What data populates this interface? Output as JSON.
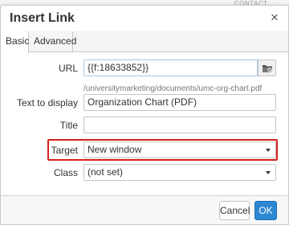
{
  "background": {
    "text": "CONTACT"
  },
  "dialog": {
    "title": "Insert Link",
    "close_glyph": "×",
    "close_icon": "close-icon"
  },
  "tabs": [
    {
      "label": "Basic",
      "active": true
    },
    {
      "label": "Advanced",
      "active": false
    }
  ],
  "form": {
    "url": {
      "label": "URL",
      "value": "{{f:18633852}}",
      "hint": "/universitymarketing/documents/umc-org-chart.pdf",
      "browse_icon": "folder-icon"
    },
    "text_to_display": {
      "label": "Text to display",
      "value": "Organization Chart (PDF)"
    },
    "title": {
      "label": "Title",
      "value": ""
    },
    "target": {
      "label": "Target",
      "value": "New window",
      "highlighted": true,
      "highlight_color": "#d62020"
    },
    "class": {
      "label": "Class",
      "value": "(not set)"
    }
  },
  "footer": {
    "cancel_label": "Cancel",
    "ok_label": "OK",
    "ok_color": "#2d88d4"
  }
}
